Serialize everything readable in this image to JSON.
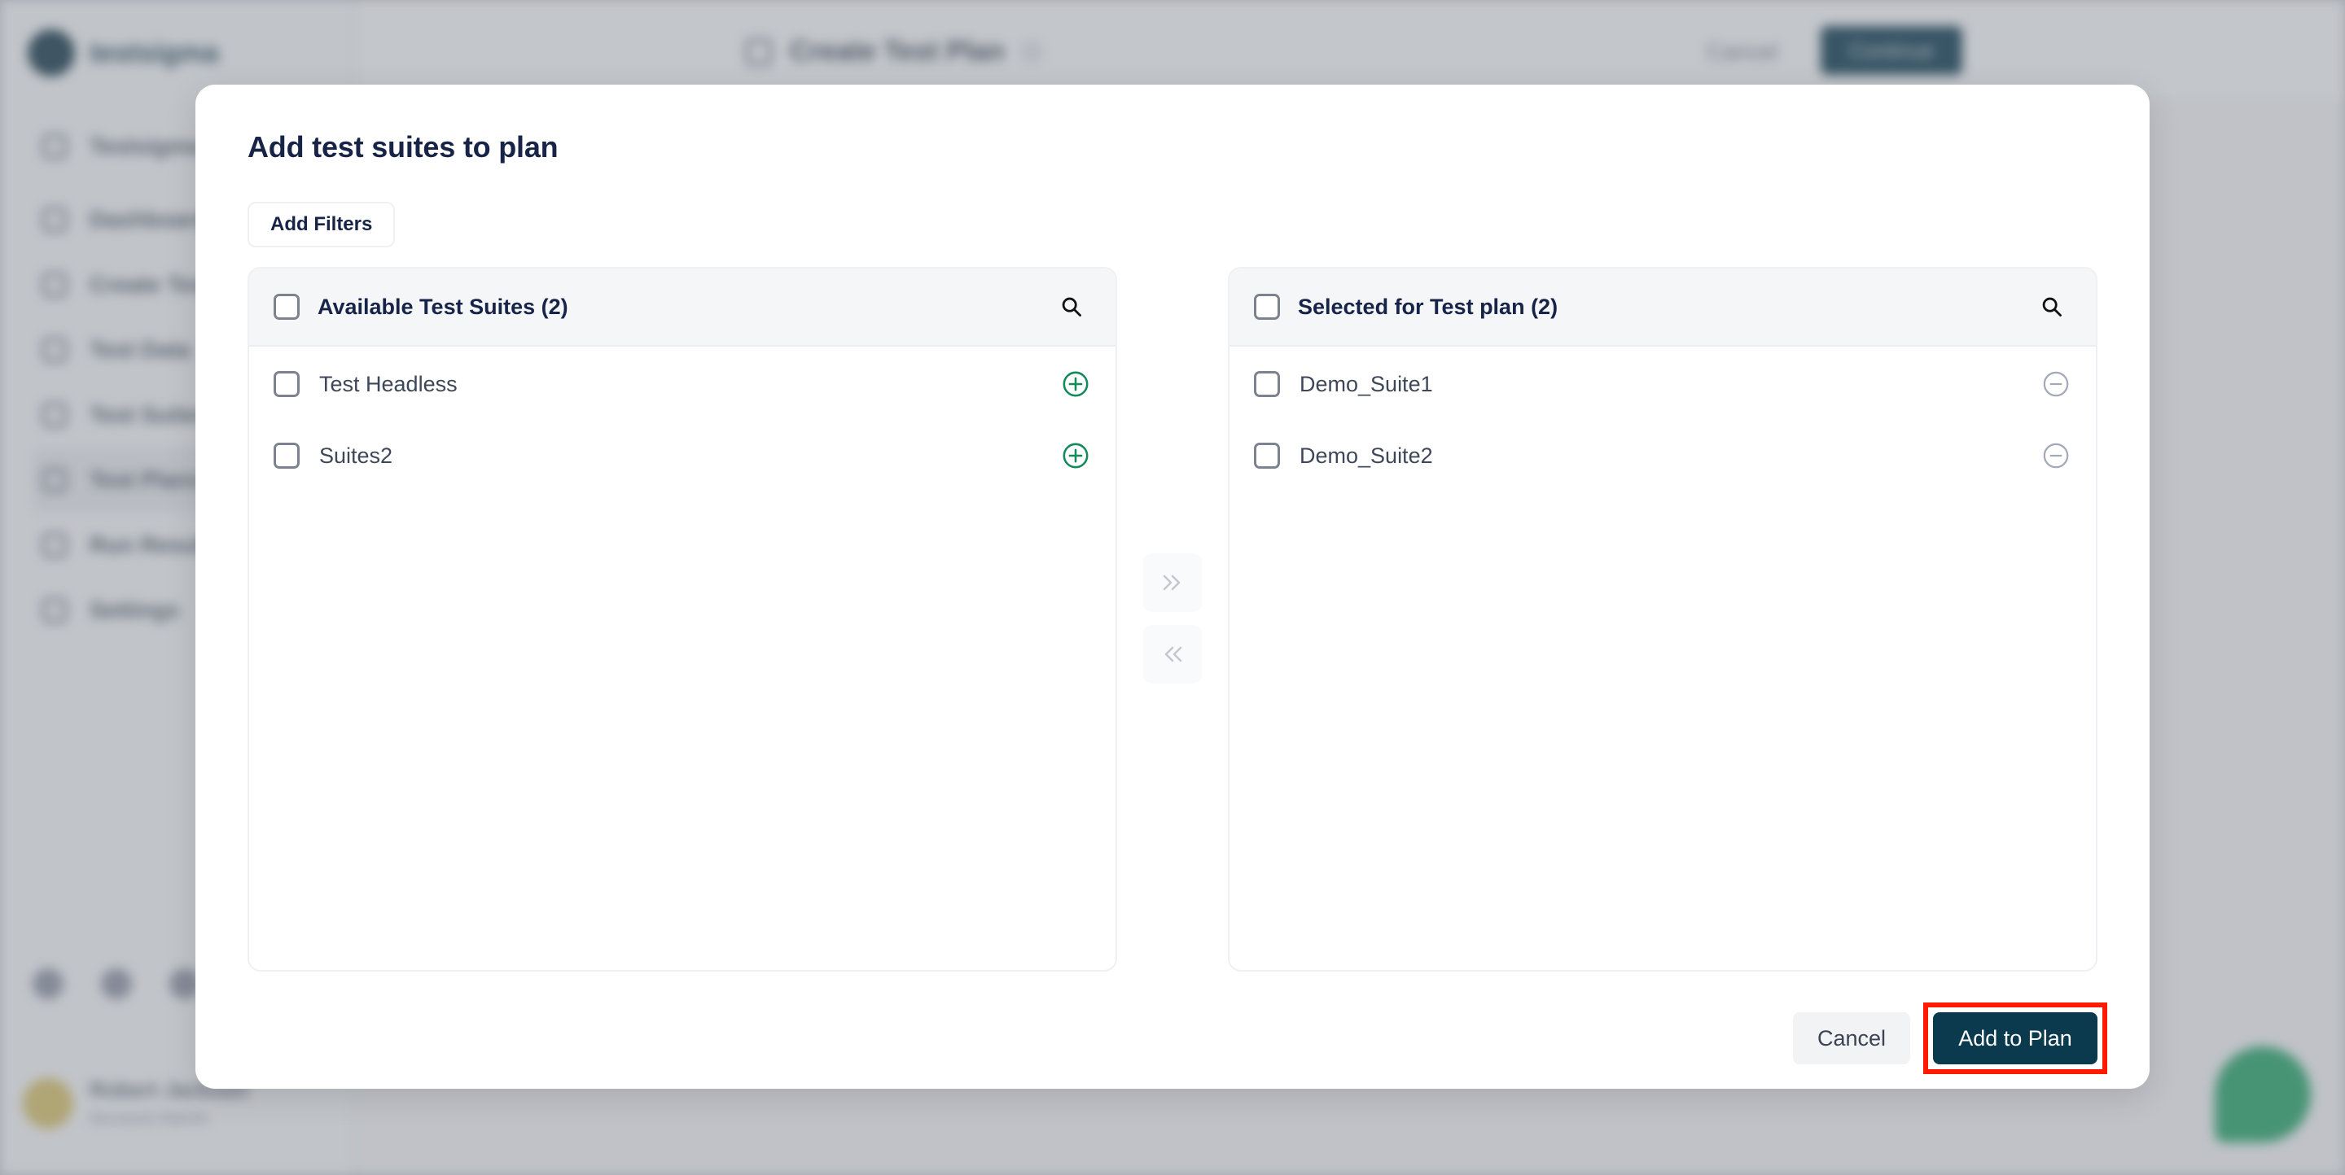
{
  "background": {
    "brand": "testsigma",
    "header_title": "Create Test Plan",
    "header_cancel": "Cancel",
    "header_continue": "Continue",
    "sidebar_items": [
      {
        "label": "Testsigma",
        "icon": "grid-icon",
        "active": false
      },
      {
        "label": "Dashboard",
        "icon": "dashboard-icon",
        "active": false
      },
      {
        "label": "Create Tests",
        "icon": "pencil-icon",
        "active": false
      },
      {
        "label": "Test Data",
        "icon": "table-icon",
        "active": false
      },
      {
        "label": "Test Suites",
        "icon": "folder-icon",
        "active": false
      },
      {
        "label": "Test Plans",
        "icon": "calendar-icon",
        "active": true
      },
      {
        "label": "Run Results",
        "icon": "chart-icon",
        "active": false
      },
      {
        "label": "Settings",
        "icon": "gear-icon",
        "active": false
      }
    ],
    "user": {
      "name": "Robert Jackson",
      "role": "Account Admin"
    }
  },
  "modal": {
    "title": "Add test suites to plan",
    "add_filters_label": "Add Filters",
    "available": {
      "title": "Available Test Suites (2)",
      "items": [
        {
          "label": "Test Headless",
          "checked": false,
          "action": "add"
        },
        {
          "label": "Suites2",
          "checked": false,
          "action": "add"
        }
      ]
    },
    "selected": {
      "title": "Selected for Test plan (2)",
      "items": [
        {
          "label": "Demo_Suite1",
          "checked": false,
          "action": "remove"
        },
        {
          "label": "Demo_Suite2",
          "checked": false,
          "action": "remove"
        }
      ]
    },
    "move_right_symbol": "»",
    "move_left_symbol": "«",
    "cancel_label": "Cancel",
    "confirm_label": "Add to Plan"
  },
  "colors": {
    "primary": "#0b3a4f",
    "add_icon": "#138a5a",
    "remove_icon": "#a3a9b8",
    "highlight": "#ff1a00",
    "title_text": "#172447"
  }
}
